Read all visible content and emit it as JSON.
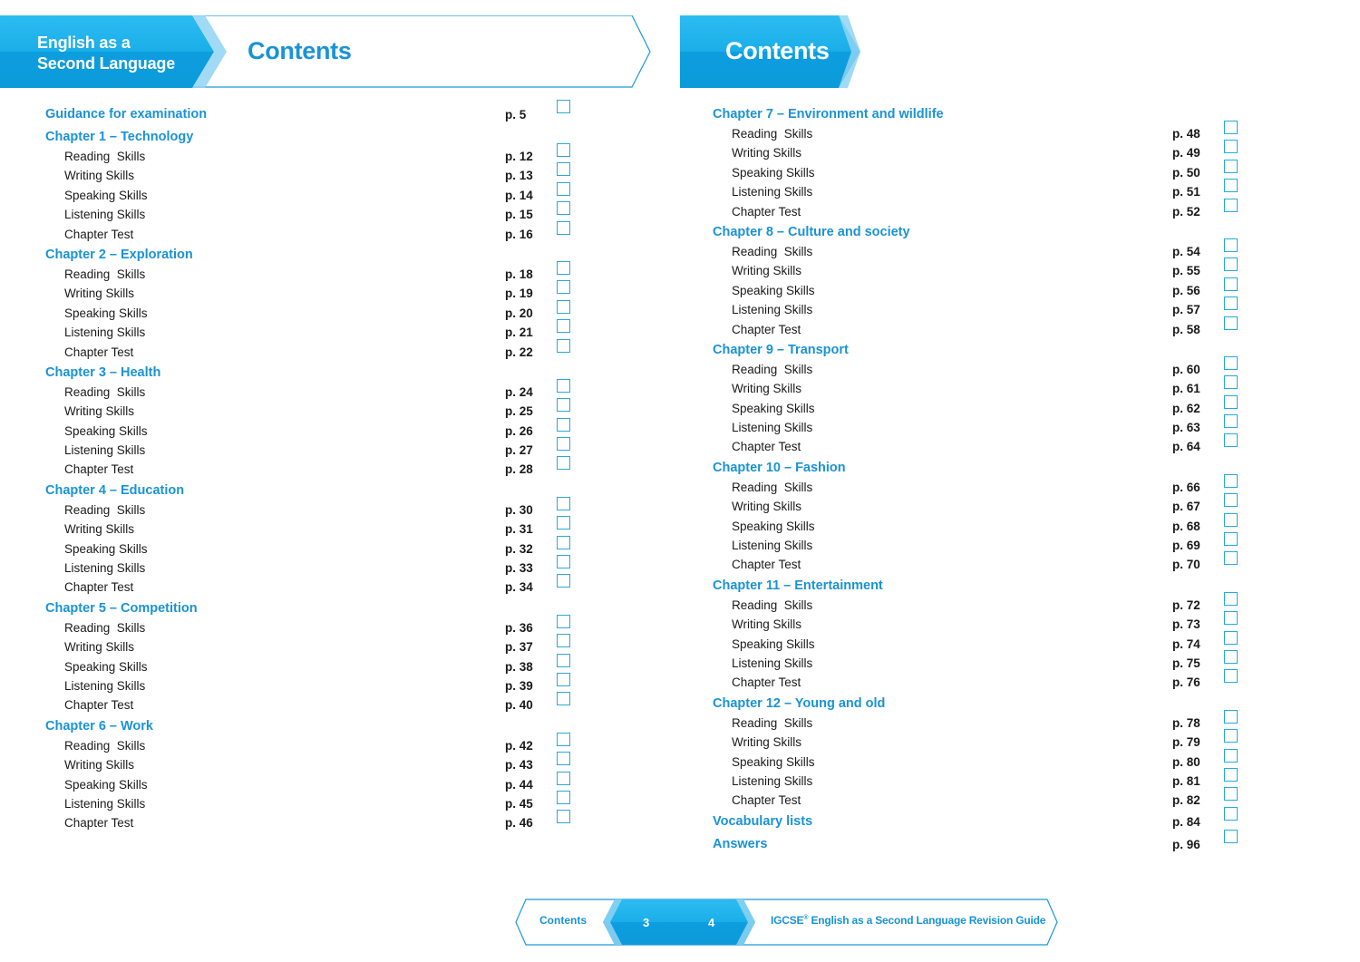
{
  "header_left": {
    "series_line1": "English as a",
    "series_line2": "Second Language",
    "title": "Contents"
  },
  "header_right": {
    "title": "Contents"
  },
  "colors": {
    "brand_blue": "#1a93d4",
    "banner_blue": "#19aee9",
    "checkbox_border": "#2aaad8"
  },
  "toc_left": [
    {
      "type": "top",
      "label": "Guidance for examination",
      "page": "p. 5"
    },
    {
      "type": "chapter",
      "label": "Chapter 1 – Technology"
    },
    {
      "type": "item",
      "label": "Reading  Skills",
      "page": "p. 12"
    },
    {
      "type": "item",
      "label": "Writing Skills",
      "page": "p. 13"
    },
    {
      "type": "item",
      "label": "Speaking Skills",
      "page": "p. 14"
    },
    {
      "type": "item",
      "label": "Listening Skills",
      "page": "p. 15"
    },
    {
      "type": "item",
      "label": "Chapter Test",
      "page": "p. 16"
    },
    {
      "type": "chapter",
      "label": "Chapter 2 – Exploration"
    },
    {
      "type": "item",
      "label": "Reading  Skills",
      "page": "p. 18"
    },
    {
      "type": "item",
      "label": "Writing Skills",
      "page": "p. 19"
    },
    {
      "type": "item",
      "label": "Speaking Skills",
      "page": "p. 20"
    },
    {
      "type": "item",
      "label": "Listening Skills",
      "page": "p. 21"
    },
    {
      "type": "item",
      "label": "Chapter Test",
      "page": "p. 22"
    },
    {
      "type": "chapter",
      "label": "Chapter 3 – Health"
    },
    {
      "type": "item",
      "label": "Reading  Skills",
      "page": "p. 24"
    },
    {
      "type": "item",
      "label": "Writing Skills",
      "page": "p. 25"
    },
    {
      "type": "item",
      "label": "Speaking Skills",
      "page": "p. 26"
    },
    {
      "type": "item",
      "label": "Listening Skills",
      "page": "p. 27"
    },
    {
      "type": "item",
      "label": "Chapter Test",
      "page": "p. 28"
    },
    {
      "type": "chapter",
      "label": "Chapter 4 – Education"
    },
    {
      "type": "item",
      "label": "Reading  Skills",
      "page": "p. 30"
    },
    {
      "type": "item",
      "label": "Writing Skills",
      "page": "p. 31"
    },
    {
      "type": "item",
      "label": "Speaking Skills",
      "page": "p. 32"
    },
    {
      "type": "item",
      "label": "Listening Skills",
      "page": "p. 33"
    },
    {
      "type": "item",
      "label": "Chapter Test",
      "page": "p. 34"
    },
    {
      "type": "chapter",
      "label": "Chapter 5 – Competition"
    },
    {
      "type": "item",
      "label": "Reading  Skills",
      "page": "p. 36"
    },
    {
      "type": "item",
      "label": "Writing Skills",
      "page": "p. 37"
    },
    {
      "type": "item",
      "label": "Speaking Skills",
      "page": "p. 38"
    },
    {
      "type": "item",
      "label": "Listening Skills",
      "page": "p. 39"
    },
    {
      "type": "item",
      "label": "Chapter Test",
      "page": "p. 40"
    },
    {
      "type": "chapter",
      "label": "Chapter 6 – Work"
    },
    {
      "type": "item",
      "label": "Reading  Skills",
      "page": "p. 42"
    },
    {
      "type": "item",
      "label": "Writing Skills",
      "page": "p. 43"
    },
    {
      "type": "item",
      "label": "Speaking Skills",
      "page": "p. 44"
    },
    {
      "type": "item",
      "label": "Listening Skills",
      "page": "p. 45"
    },
    {
      "type": "item",
      "label": "Chapter Test",
      "page": "p. 46"
    }
  ],
  "toc_right": [
    {
      "type": "chapter",
      "label": "Chapter 7 – Environment and wildlife"
    },
    {
      "type": "item",
      "label": "Reading  Skills",
      "page": "p. 48"
    },
    {
      "type": "item",
      "label": "Writing Skills",
      "page": "p. 49"
    },
    {
      "type": "item",
      "label": "Speaking Skills",
      "page": "p. 50"
    },
    {
      "type": "item",
      "label": "Listening Skills",
      "page": "p. 51"
    },
    {
      "type": "item",
      "label": "Chapter Test",
      "page": "p. 52"
    },
    {
      "type": "chapter",
      "label": "Chapter 8 – Culture and society"
    },
    {
      "type": "item",
      "label": "Reading  Skills",
      "page": "p. 54"
    },
    {
      "type": "item",
      "label": "Writing Skills",
      "page": "p. 55"
    },
    {
      "type": "item",
      "label": "Speaking Skills",
      "page": "p. 56"
    },
    {
      "type": "item",
      "label": "Listening Skills",
      "page": "p. 57"
    },
    {
      "type": "item",
      "label": "Chapter Test",
      "page": "p. 58"
    },
    {
      "type": "chapter",
      "label": "Chapter 9 – Transport"
    },
    {
      "type": "item",
      "label": "Reading  Skills",
      "page": "p. 60"
    },
    {
      "type": "item",
      "label": "Writing Skills",
      "page": "p. 61"
    },
    {
      "type": "item",
      "label": "Speaking Skills",
      "page": "p. 62"
    },
    {
      "type": "item",
      "label": "Listening Skills",
      "page": "p. 63"
    },
    {
      "type": "item",
      "label": "Chapter Test",
      "page": "p. 64"
    },
    {
      "type": "chapter",
      "label": "Chapter 10 – Fashion"
    },
    {
      "type": "item",
      "label": "Reading  Skills",
      "page": "p. 66"
    },
    {
      "type": "item",
      "label": "Writing Skills",
      "page": "p. 67"
    },
    {
      "type": "item",
      "label": "Speaking Skills",
      "page": "p. 68"
    },
    {
      "type": "item",
      "label": "Listening Skills",
      "page": "p. 69"
    },
    {
      "type": "item",
      "label": "Chapter Test",
      "page": "p. 70"
    },
    {
      "type": "chapter",
      "label": "Chapter 11 – Entertainment"
    },
    {
      "type": "item",
      "label": "Reading  Skills",
      "page": "p. 72"
    },
    {
      "type": "item",
      "label": "Writing Skills",
      "page": "p. 73"
    },
    {
      "type": "item",
      "label": "Speaking Skills",
      "page": "p. 74"
    },
    {
      "type": "item",
      "label": "Listening Skills",
      "page": "p. 75"
    },
    {
      "type": "item",
      "label": "Chapter Test",
      "page": "p. 76"
    },
    {
      "type": "chapter",
      "label": "Chapter 12 – Young and old"
    },
    {
      "type": "item",
      "label": "Reading  Skills",
      "page": "p. 78"
    },
    {
      "type": "item",
      "label": "Writing Skills",
      "page": "p. 79"
    },
    {
      "type": "item",
      "label": "Speaking Skills",
      "page": "p. 80"
    },
    {
      "type": "item",
      "label": "Listening Skills",
      "page": "p. 81"
    },
    {
      "type": "item",
      "label": "Chapter Test",
      "page": "p. 82"
    },
    {
      "type": "top",
      "label": "Vocabulary lists",
      "page": "p. 84"
    },
    {
      "type": "top",
      "label": "Answers",
      "page": "p. 96"
    }
  ],
  "footer": {
    "left_label": "Contents",
    "page_left": "3",
    "page_right": "4",
    "right_label": "IGCSE",
    "right_label_mark": "®",
    "right_label_rest": " English as a Second Language Revision Guide"
  }
}
